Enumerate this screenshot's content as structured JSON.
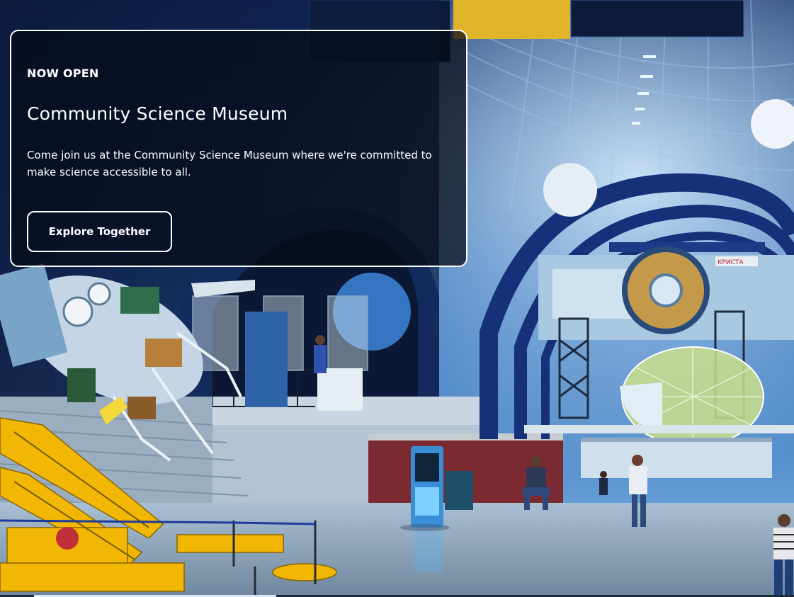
{
  "hero": {
    "eyebrow": "NOW OPEN",
    "title": "Community Science Museum",
    "description": "Come join us at the Community Science Museum where we're committed to make science accessible to all.",
    "cta_label": "Explore Together"
  },
  "signage": {
    "station_label": "КРИСТА"
  },
  "colors": {
    "card_background": "rgba(6,10,22,0.72)",
    "card_border": "#ffffff",
    "text": "#ffffff",
    "arch_blue": "#16317a",
    "rocket_yellow": "#f2b705"
  }
}
